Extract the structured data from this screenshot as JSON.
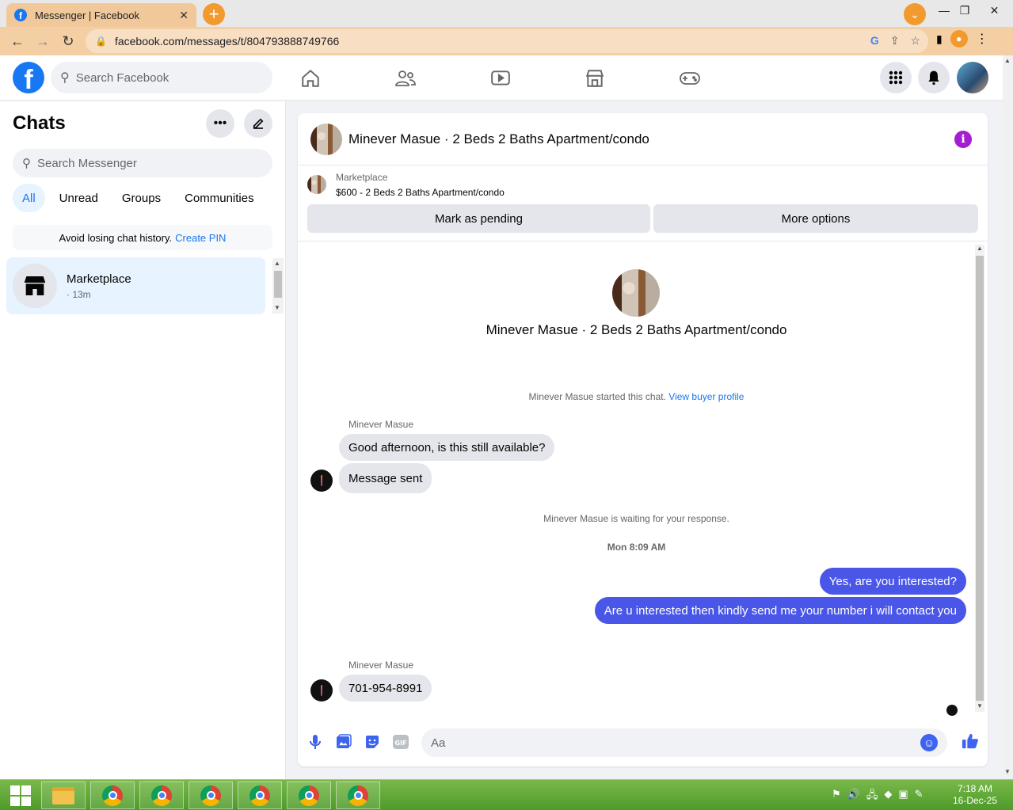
{
  "browser": {
    "tab_title": "Messenger | Facebook",
    "url": "facebook.com/messages/t/804793888749766",
    "fb_favicon_letter": "f"
  },
  "fb_header": {
    "logo_letter": "f",
    "search_placeholder": "Search Facebook"
  },
  "sidebar": {
    "title": "Chats",
    "search_placeholder": "Search Messenger",
    "filters": [
      "All",
      "Unread",
      "Groups",
      "Communities"
    ],
    "pin_text": "Avoid losing chat history.",
    "pin_link": "Create PIN",
    "chats": [
      {
        "name": "Marketplace",
        "time": "· 13m"
      }
    ]
  },
  "conversation": {
    "title": "Minever Masue · 2 Beds 2 Baths Apartment/condo",
    "info_glyph": "i",
    "listing": {
      "label": "Marketplace",
      "price_line": "$600 - 2 Beds 2 Baths Apartment/condo",
      "mark_pending": "Mark as pending",
      "more_options": "More options"
    },
    "intro_title": "Minever Masue · 2 Beds 2 Baths Apartment/condo",
    "started_text": "Minever Masue started this chat.",
    "view_profile": "View buyer profile",
    "sender_name": "Minever Masue",
    "messages": [
      {
        "from": "in",
        "text": "Good afternoon, is this still available?"
      },
      {
        "from": "in",
        "text": "Message sent"
      },
      {
        "from": "out",
        "text": "Yes, are you interested?"
      },
      {
        "from": "out",
        "text": "Are u interested then kindly send me your number i will contact you"
      },
      {
        "from": "in",
        "text": "701-954-8991"
      }
    ],
    "waiting_text": "Minever Masue is waiting for your response.",
    "timestamp": "Mon 8:09 AM",
    "composer_placeholder": "Aa"
  },
  "taskbar": {
    "time": "7:18 AM",
    "date": "16-Dec-25"
  },
  "colors": {
    "fb_blue": "#1877f2",
    "outgoing_bubble": "#4a56e8",
    "info_purple": "#a31dd1",
    "taskbar_green": "#4e9a2a"
  },
  "icons": [
    "home-icon",
    "friends-icon",
    "watch-icon",
    "marketplace-icon",
    "gaming-icon",
    "menu-grid-icon",
    "messenger-icon",
    "mic-icon",
    "image-icon",
    "sticker-icon",
    "gif-icon",
    "emoji-icon",
    "like-icon"
  ]
}
